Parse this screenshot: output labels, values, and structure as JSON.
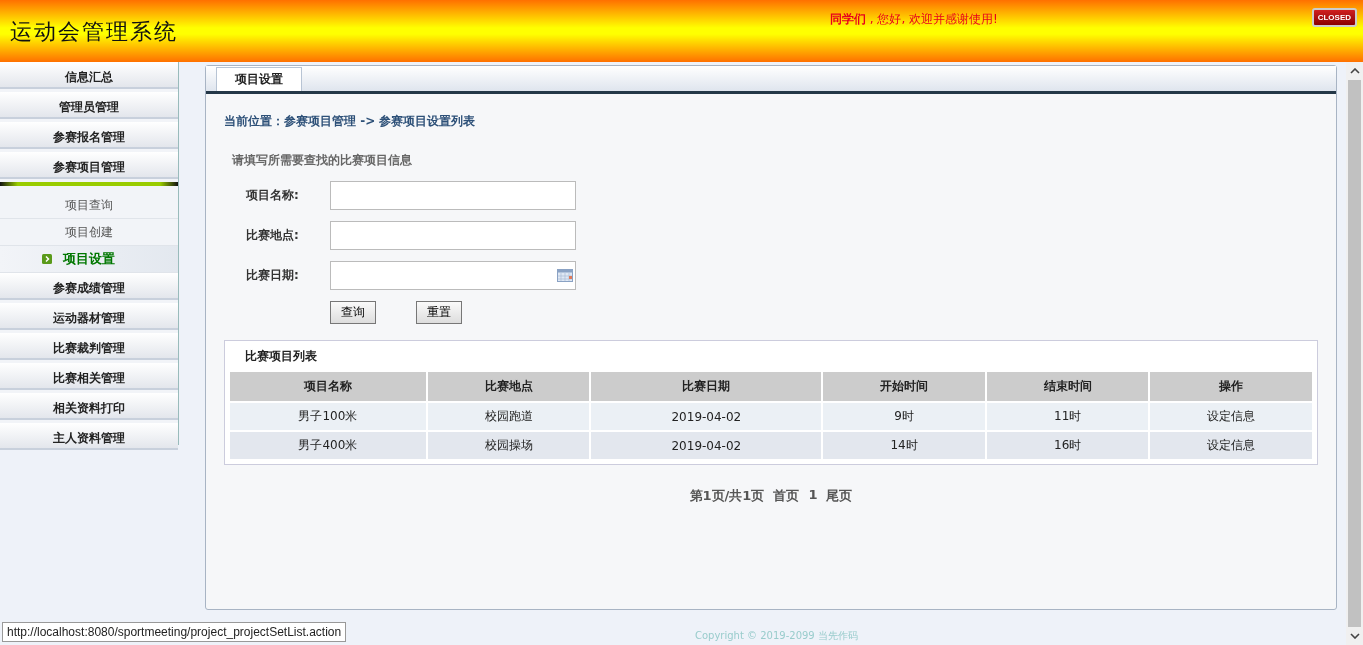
{
  "header": {
    "title": "运动会管理系统",
    "greeting_name": "同学们",
    "greeting_text": " , 您好, 欢迎并感谢使用!",
    "close_button": "CLOSED"
  },
  "sidebar": {
    "items": [
      {
        "kind": "group",
        "label": "信息汇总",
        "selected": false
      },
      {
        "kind": "group",
        "label": "管理员管理",
        "selected": false
      },
      {
        "kind": "group",
        "label": "参赛报名管理",
        "selected": false
      },
      {
        "kind": "group",
        "label": "参赛项目管理",
        "selected": false
      },
      {
        "kind": "divider"
      },
      {
        "kind": "sub",
        "label": "项目查询",
        "selected": false
      },
      {
        "kind": "sub",
        "label": "项目创建",
        "selected": false
      },
      {
        "kind": "sub",
        "label": "项目设置",
        "selected": true
      },
      {
        "kind": "group",
        "label": "参赛成绩管理",
        "selected": false
      },
      {
        "kind": "group",
        "label": "运动器材管理",
        "selected": false
      },
      {
        "kind": "group",
        "label": "比赛裁判管理",
        "selected": false
      },
      {
        "kind": "group",
        "label": "比赛相关管理",
        "selected": false
      },
      {
        "kind": "group",
        "label": "相关资料打印",
        "selected": false
      },
      {
        "kind": "group",
        "label": "主人资料管理",
        "selected": false
      }
    ]
  },
  "tabs": [
    {
      "label": "项目设置",
      "selected": true
    }
  ],
  "breadcrumb": "当前位置：参赛项目管理 -> 参赛项目设置列表",
  "search": {
    "title": "请填写所需要查找的比赛项目信息",
    "fields": [
      {
        "label": "项目名称:",
        "kind": "text"
      },
      {
        "label": "比赛地点:",
        "kind": "text"
      },
      {
        "label": "比赛日期:",
        "kind": "date"
      }
    ],
    "buttons": [
      "查询",
      "重置"
    ]
  },
  "table": {
    "title": "比赛项目列表",
    "columns": [
      "项目名称",
      "比赛地点",
      "比赛日期",
      "开始时间",
      "结束时间",
      "操作"
    ],
    "rows": [
      [
        "男子100米",
        "校园跑道",
        "2019-04-02",
        "9时",
        "11时",
        "设定信息"
      ],
      [
        "男子400米",
        "校园操场",
        "2019-04-02",
        "14时",
        "16时",
        "设定信息"
      ]
    ]
  },
  "pagination": {
    "summary": "第1页/共1页",
    "first": "首页",
    "page": "1",
    "last": "尾页"
  },
  "footer": "Copyright © 2019-2099 当先作码",
  "status_url": "http://localhost:8080/sportmeeting/project_projectSetList.action"
}
